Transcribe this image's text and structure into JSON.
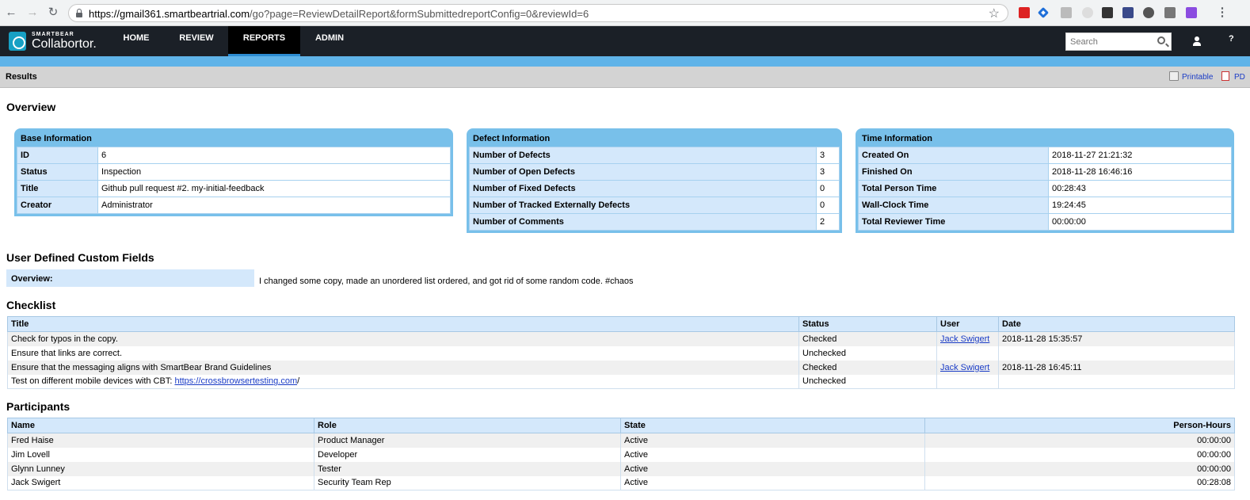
{
  "browser": {
    "url_host": "https://gmail361.smartbeartrial.com",
    "url_path": "/go?page=ReviewDetailReport&formSubmittedreportConfig=0&reviewId=6"
  },
  "app": {
    "brand_small": "SMARTBEAR",
    "brand_name": "Collabortor.",
    "nav": [
      "HOME",
      "REVIEW",
      "REPORTS",
      "ADMIN"
    ],
    "active_nav": "REPORTS",
    "search_placeholder": "Search",
    "help": "?"
  },
  "results_bar": {
    "title": "Results",
    "printable": "Printable",
    "pdf": "PD"
  },
  "overview": {
    "heading": "Overview",
    "base": {
      "title": "Base Information",
      "rows": [
        {
          "label": "ID",
          "value": "6"
        },
        {
          "label": "Status",
          "value": "Inspection"
        },
        {
          "label": "Title",
          "value": "Github pull request #2. my-initial-feedback"
        },
        {
          "label": "Creator",
          "value": "Administrator"
        }
      ]
    },
    "defect": {
      "title": "Defect Information",
      "rows": [
        {
          "label": "Number of Defects",
          "value": "3"
        },
        {
          "label": "Number of Open Defects",
          "value": "3"
        },
        {
          "label": "Number of Fixed Defects",
          "value": "0"
        },
        {
          "label": "Number of Tracked Externally Defects",
          "value": "0"
        },
        {
          "label": "Number of Comments",
          "value": "2"
        }
      ]
    },
    "time": {
      "title": "Time Information",
      "rows": [
        {
          "label": "Created On",
          "value": "2018-11-27 21:21:32"
        },
        {
          "label": "Finished On",
          "value": "2018-11-28 16:46:16"
        },
        {
          "label": "Total Person Time",
          "value": "00:28:43"
        },
        {
          "label": "Wall-Clock Time",
          "value": "19:24:45"
        },
        {
          "label": "Total Reviewer Time",
          "value": "00:00:00"
        }
      ]
    }
  },
  "custom_fields": {
    "heading": "User Defined Custom Fields",
    "label": "Overview:",
    "value": "I changed some copy, made an unordered list ordered, and got rid of some random code. #chaos"
  },
  "checklist": {
    "heading": "Checklist",
    "columns": [
      "Title",
      "Status",
      "User",
      "Date"
    ],
    "rows": [
      {
        "title": "Check for typos in the copy.",
        "status": "Checked",
        "user": "Jack Swigert",
        "date": "2018-11-28 15:35:57"
      },
      {
        "title": "Ensure that links are correct.",
        "status": "Unchecked",
        "user": "",
        "date": ""
      },
      {
        "title": "Ensure that the messaging aligns with SmartBear Brand Guidelines",
        "status": "Checked",
        "user": "Jack Swigert",
        "date": "2018-11-28 16:45:11"
      },
      {
        "title_prefix": "Test on different mobile devices with CBT: ",
        "title_link": "https://crossbrowsertesting.com",
        "title_suffix": "/",
        "status": "Unchecked",
        "user": "",
        "date": ""
      }
    ]
  },
  "participants": {
    "heading": "Participants",
    "columns": [
      "Name",
      "Role",
      "State",
      "Person-Hours"
    ],
    "rows": [
      {
        "name": "Fred Haise",
        "role": "Product Manager",
        "state": "Active",
        "hours": "00:00:00"
      },
      {
        "name": "Jim Lovell",
        "role": "Developer",
        "state": "Active",
        "hours": "00:00:00"
      },
      {
        "name": "Glynn Lunney",
        "role": "Tester",
        "state": "Active",
        "hours": "00:00:00"
      },
      {
        "name": "Jack Swigert",
        "role": "Security Team Rep",
        "state": "Active",
        "hours": "00:28:08"
      }
    ]
  }
}
